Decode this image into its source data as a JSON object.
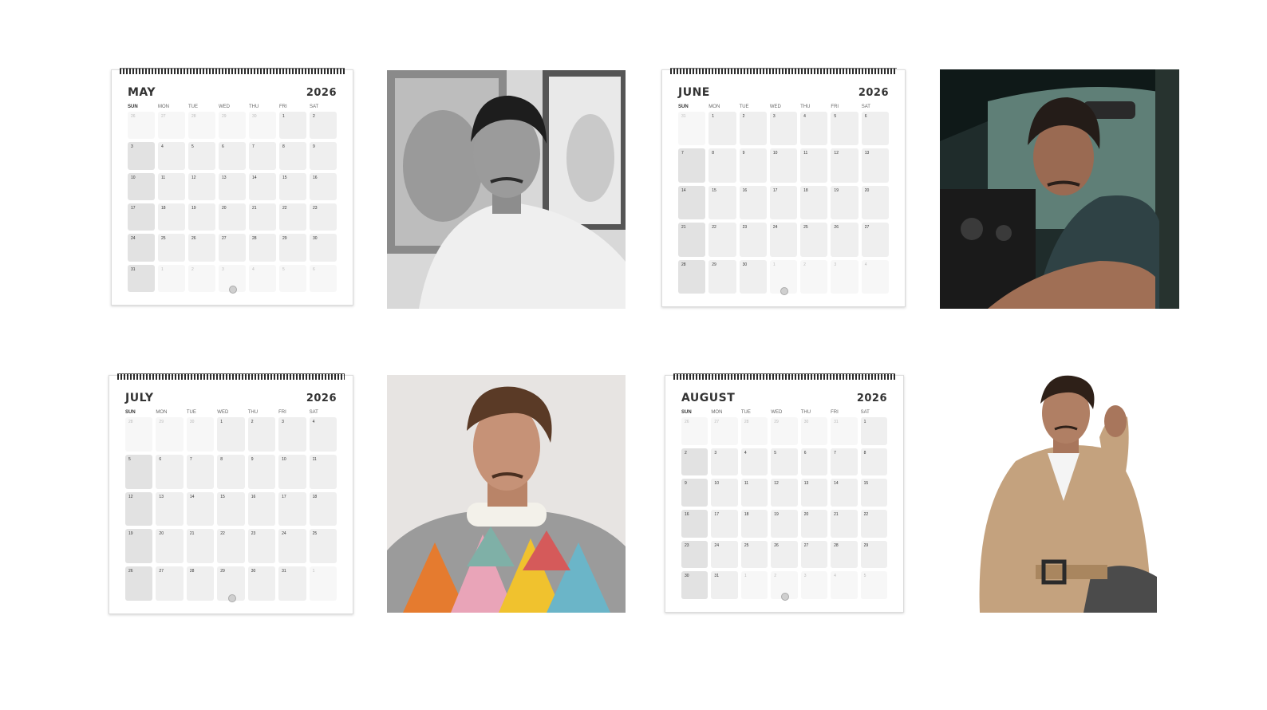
{
  "weekdays": [
    "SUN",
    "MON",
    "TUE",
    "WED",
    "THU",
    "FRI",
    "SAT"
  ],
  "calendars": [
    {
      "month": "MAY",
      "year": "2026",
      "start": 5,
      "days": 31,
      "prev_days": 30
    },
    {
      "month": "JUNE",
      "year": "2026",
      "start": 1,
      "days": 30,
      "prev_days": 31
    },
    {
      "month": "JULY",
      "year": "2026",
      "start": 3,
      "days": 31,
      "prev_days": 30
    },
    {
      "month": "AUGUST",
      "year": "2026",
      "start": 6,
      "days": 31,
      "prev_days": 31
    }
  ],
  "photos": [
    {
      "name": "bw-portrait-white-tshirt"
    },
    {
      "name": "portrait-in-truck-denim-vest"
    },
    {
      "name": "portrait-colorful-knit-sweater"
    },
    {
      "name": "portrait-tan-trench-coat"
    }
  ],
  "colors": {
    "cell": "#efefef",
    "sunday_cell": "#e2e2e2",
    "outside_cell": "#f7f7f7"
  }
}
